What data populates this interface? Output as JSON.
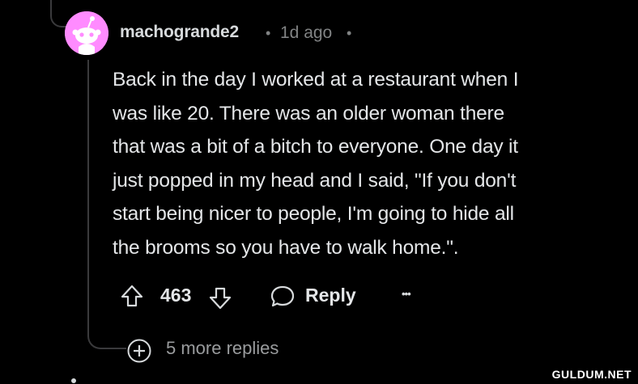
{
  "comment": {
    "username": "machogrande2",
    "separator": "•",
    "timestamp": "1d ago",
    "body_lines": [
      "Back in the day I worked at a restaurant when I",
      "was like 20. There was an older woman there",
      "that was a bit of a bitch to everyone. One day it",
      "just popped in my head and I said, \"If you don't",
      "start being nicer to people, I'm going to hide all",
      "the brooms so you have to walk home.\"."
    ],
    "avatar_color": "#ff8bff"
  },
  "actions": {
    "upvote_icon": "arrow-up-icon",
    "vote_count": "463",
    "downvote_icon": "arrow-down-icon",
    "reply_icon": "speech-bubble-icon",
    "reply_label": "Reply",
    "more_icon": "ellipsis-icon",
    "more_glyph": "•••"
  },
  "replies": {
    "expand_icon": "plus-circle-icon",
    "more_replies_label": "5 more replies"
  },
  "watermark": "GULDUM.NET"
}
